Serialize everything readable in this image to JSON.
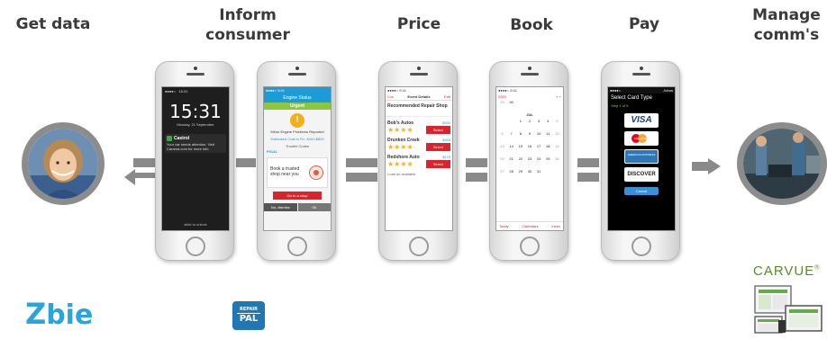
{
  "stages": [
    {
      "id": "get-data",
      "title": "Get data"
    },
    {
      "id": "inform",
      "title": "Inform\nconsumer"
    },
    {
      "id": "price",
      "title": "Price"
    },
    {
      "id": "book",
      "title": "Book"
    },
    {
      "id": "pay",
      "title": "Pay"
    },
    {
      "id": "manage",
      "title": "Manage\ncomm's"
    }
  ],
  "phone1": {
    "time": "15:31",
    "date": "Monday, 21 September",
    "notif_app": "Castrol",
    "notif_text": "Your car needs attention. Visit Carama.com for more info",
    "unlock": "slide to unlock"
  },
  "phone2": {
    "header": "Engine Status",
    "status": "Urgent",
    "problem": "Minor Engine Problems Reported",
    "contact": "Estimated Cost to Fix: $400-$800",
    "trouble": "Trouble Codes",
    "code": "P0141",
    "card_text": "Book a trusted shop near you",
    "cta": "Go to a shop",
    "btn_left": "No, dismiss",
    "btn_right": "Ok"
  },
  "phone3": {
    "header": "Event Details",
    "back": "Cxx",
    "edit": "Edit",
    "shop_heading": "Recommended Repair Shop",
    "shops": [
      {
        "name": "Bob's Autos",
        "price": "$450",
        "select": "Select"
      },
      {
        "name": "Drunken Creek",
        "price": "$465",
        "select": "Select"
      },
      {
        "name": "Redshore Auto",
        "price": "$475",
        "select": "Select"
      }
    ],
    "footer": "Load ad available"
  },
  "phone4": {
    "back": "2015",
    "month": "JUL",
    "rows": [
      [
        "29",
        "30",
        "",
        "",
        "",
        "",
        ""
      ],
      [
        "",
        "",
        "1",
        "2",
        "3",
        "4",
        "5"
      ],
      [
        "6",
        "7",
        "8",
        "9",
        "10",
        "11",
        "12"
      ],
      [
        "13",
        "14",
        "15",
        "16",
        "17",
        "18",
        "19"
      ],
      [
        "20",
        "21",
        "22",
        "23",
        "24",
        "25",
        "26"
      ],
      [
        "27",
        "28",
        "29",
        "30",
        "31",
        "",
        ""
      ]
    ],
    "tab_today": "Today",
    "tab_calendars": "Calendars",
    "tab_inbox": "Inbox"
  },
  "phone5": {
    "header_right": "Johns",
    "title": "Select Card Type",
    "step": "Step 1 of 5",
    "cards": [
      "VISA",
      "MasterCard",
      "AMERICAN EXPRESS",
      "DISCOVER"
    ],
    "cancel": "Cancel"
  },
  "logos": {
    "zubie_z": "Z",
    "zubie_rest": "bie",
    "repairpal_top": "REPAIR",
    "repairpal_bottom": "PAL",
    "carvue": "CARVUE",
    "carvue_mark": "®"
  },
  "colors": {
    "red": "#d9232d",
    "dark_red": "#b01c24",
    "gold": "#f2b01e",
    "gray_connector": "#8a8a8a",
    "zubie_blue": "#2aa4d9",
    "zubie_green": "#8cc63f",
    "repairpal_blue": "#1f78b4",
    "carvue_green": "#5a8a2a"
  }
}
